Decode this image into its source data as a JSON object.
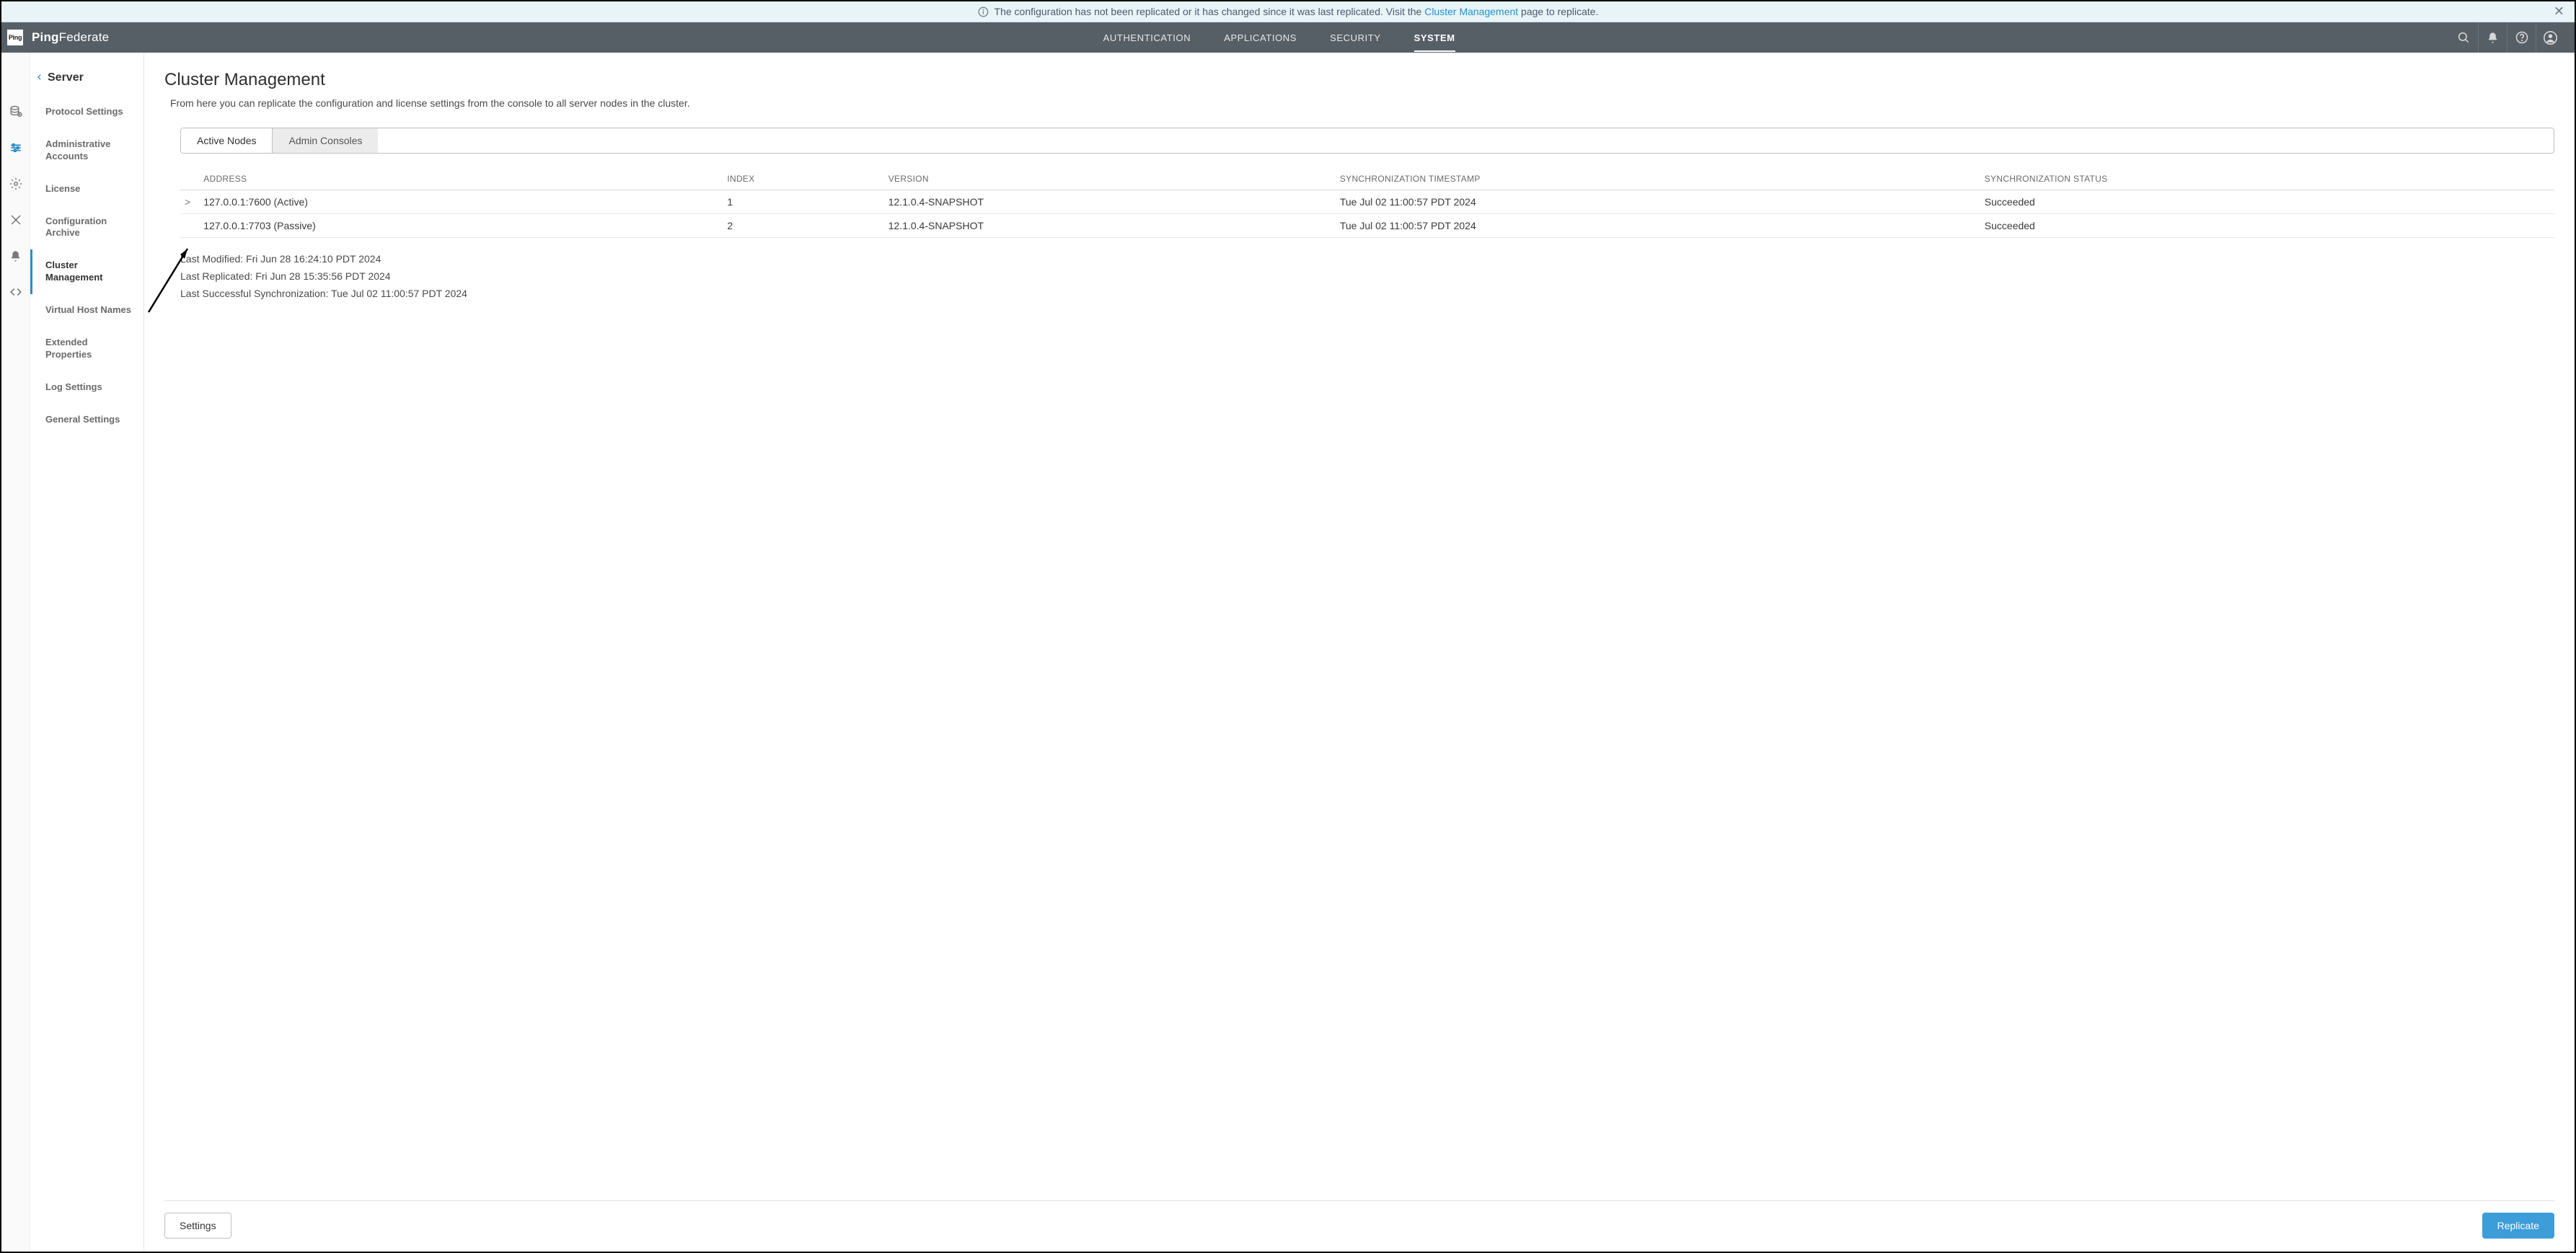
{
  "notification": {
    "text_prefix": "The configuration has not been replicated or it has changed since it was last replicated. Visit the ",
    "link_text": "Cluster Management",
    "text_suffix": " page to replicate."
  },
  "brand": {
    "logo": "Ping",
    "name_bold": "Ping",
    "name_light": "Federate"
  },
  "top_nav": {
    "items": [
      {
        "label": "AUTHENTICATION",
        "active": false
      },
      {
        "label": "APPLICATIONS",
        "active": false
      },
      {
        "label": "SECURITY",
        "active": false
      },
      {
        "label": "SYSTEM",
        "active": true
      }
    ]
  },
  "sidebar": {
    "header": "Server",
    "items": [
      {
        "label": "Protocol Settings"
      },
      {
        "label": "Administrative Accounts"
      },
      {
        "label": "License"
      },
      {
        "label": "Configuration Archive"
      },
      {
        "label": "Cluster Management",
        "active": true
      },
      {
        "label": "Virtual Host Names"
      },
      {
        "label": "Extended Properties"
      },
      {
        "label": "Log Settings"
      },
      {
        "label": "General Settings"
      }
    ]
  },
  "rail_icons": [
    "database-icon",
    "sliders-icon",
    "gear-icon",
    "xy-axes-icon",
    "bell-icon",
    "code-icon"
  ],
  "page": {
    "title": "Cluster Management",
    "description": "From here you can replicate the configuration and license settings from the console to all server nodes in the cluster."
  },
  "view_tabs": {
    "active": "Active Nodes",
    "inactive": "Admin Consoles"
  },
  "table": {
    "headers": {
      "address": "ADDRESS",
      "index": "INDEX",
      "version": "VERSION",
      "sync_ts": "SYNCHRONIZATION TIMESTAMP",
      "sync_status": "SYNCHRONIZATION STATUS"
    },
    "rows": [
      {
        "expandable": true,
        "address": "127.0.0.1:7600 (Active)",
        "index": "1",
        "version": "12.1.0.4-SNAPSHOT",
        "sync_ts": "Tue Jul 02 11:00:57 PDT 2024",
        "sync_status": "Succeeded"
      },
      {
        "expandable": false,
        "address": "127.0.0.1:7703 (Passive)",
        "index": "2",
        "version": "12.1.0.4-SNAPSHOT",
        "sync_ts": "Tue Jul 02 11:00:57 PDT 2024",
        "sync_status": "Succeeded"
      }
    ]
  },
  "meta": {
    "last_modified": "Last Modified: Fri Jun 28 16:24:10 PDT 2024",
    "last_replicated": "Last Replicated: Fri Jun 28 15:35:56 PDT 2024",
    "last_sync": "Last Successful Synchronization: Tue Jul 02 11:00:57 PDT 2024"
  },
  "buttons": {
    "settings": "Settings",
    "replicate": "Replicate"
  }
}
